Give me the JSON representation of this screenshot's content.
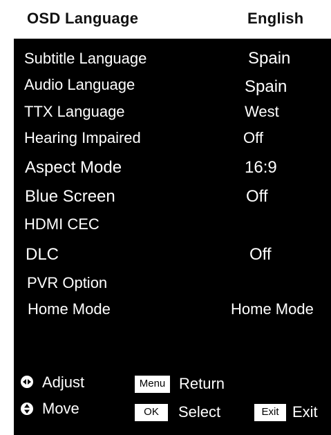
{
  "header": {
    "title": "OSD Language",
    "value": "English"
  },
  "menu": {
    "items": [
      {
        "label": "Subtitle   Language",
        "value": "Spain"
      },
      {
        "label": "Audio Language",
        "value": "Spain"
      },
      {
        "label": "TTX Language",
        "value": "West"
      },
      {
        "label": "Hearing Impaired",
        "value": "Off"
      },
      {
        "label": "Aspect Mode",
        "value": "16:9"
      },
      {
        "label": "Blue Screen",
        "value": "Off"
      },
      {
        "label": "HDMI CEC",
        "value": ""
      },
      {
        "label": "DLC",
        "value": "Off"
      },
      {
        "label": "PVR Option",
        "value": ""
      },
      {
        "label": "Home Mode",
        "value": "Home Mode"
      }
    ]
  },
  "footer": {
    "adjust_label": "Adjust",
    "move_label": "Move",
    "menu_key": "Menu",
    "return_label": "Return",
    "ok_key": "OK",
    "select_label": "Select",
    "exit_key": "Exit",
    "exit_label": "Exit",
    "adjust_icon": "left-right-arrows-icon",
    "move_icon": "up-down-arrows-icon"
  },
  "colors": {
    "panel_background": "#000000",
    "header_background": "#ffffff",
    "text_on_panel": "#ffffff",
    "header_text": "#111111"
  }
}
